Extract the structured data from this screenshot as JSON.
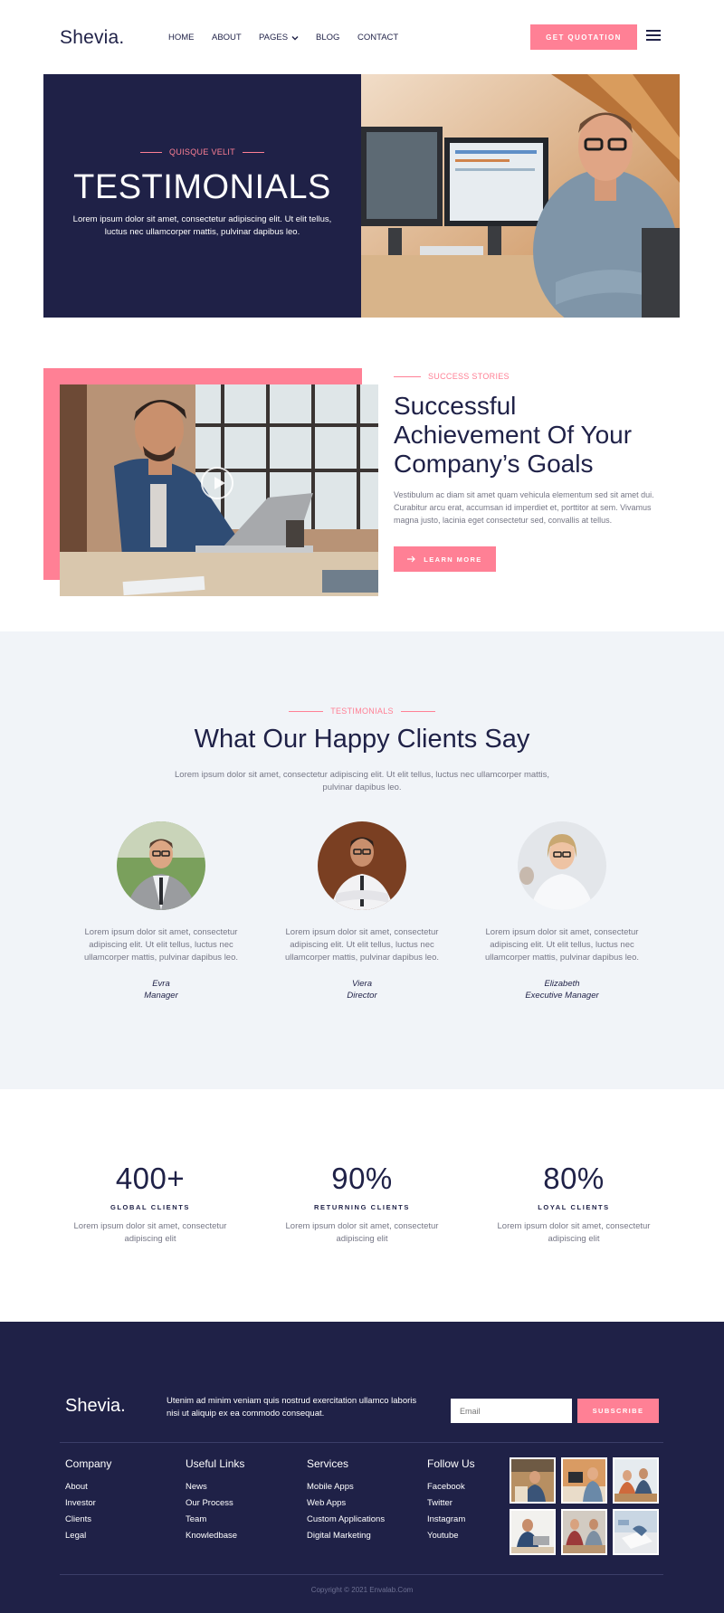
{
  "header": {
    "logo": "Shevia.",
    "nav": [
      {
        "label": "HOME"
      },
      {
        "label": "ABOUT"
      },
      {
        "label": "PAGES"
      },
      {
        "label": "BLOG"
      },
      {
        "label": "CONTACT"
      }
    ],
    "quote_button": "GET QUOTATION",
    "menu_icon": "hamburger-icon"
  },
  "hero": {
    "eyebrow": "QUISQUE VELIT",
    "title": "TESTIMONIALS",
    "subtitle": "Lorem ipsum dolor sit amet, consectetur adipiscing elit. Ut elit tellus, luctus nec ullamcorper mattis, pulvinar dapibus leo."
  },
  "success": {
    "eyebrow": "SUCCESS STORIES",
    "title": "Successful Achievement Of Your Company’s Goals",
    "text": "Vestibulum ac diam sit amet quam vehicula elementum sed sit amet dui. Curabitur arcu erat, accumsan id imperdiet et, porttitor at sem. Vivamus magna justo, lacinia eget consectetur sed, convallis at tellus.",
    "button": "LEARN MORE",
    "button_icon": "arrow-right-icon",
    "video_icon": "play-icon"
  },
  "testimonials": {
    "eyebrow": "TESTIMONIALS",
    "title": "What Our Happy Clients Say",
    "subtitle": "Lorem ipsum dolor sit amet, consectetur adipiscing elit. Ut elit tellus, luctus nec ullamcorper mattis, pulvinar dapibus leo.",
    "items": [
      {
        "quote": "Lorem ipsum dolor sit amet, consectetur adipiscing elit. Ut elit tellus, luctus nec ullamcorper mattis, pulvinar dapibus leo.",
        "name": "Evra",
        "role": "Manager"
      },
      {
        "quote": "Lorem ipsum dolor sit amet, consectetur adipiscing elit. Ut elit tellus, luctus nec ullamcorper mattis, pulvinar dapibus leo.",
        "name": "Viera",
        "role": "Director"
      },
      {
        "quote": "Lorem ipsum dolor sit amet, consectetur adipiscing elit. Ut elit tellus, luctus nec ullamcorper mattis, pulvinar dapibus leo.",
        "name": "Elizabeth",
        "role": "Executive Manager"
      }
    ]
  },
  "stats": [
    {
      "number": "400+",
      "label": "GLOBAL CLIENTS",
      "desc": "Lorem ipsum dolor sit amet, consectetur adipiscing elit"
    },
    {
      "number": "90%",
      "label": "RETURNING CLIENTS",
      "desc": "Lorem ipsum dolor sit amet, consectetur adipiscing elit"
    },
    {
      "number": "80%",
      "label": "LOYAL CLIENTS",
      "desc": "Lorem ipsum dolor sit amet, consectetur adipiscing elit"
    }
  ],
  "footer": {
    "logo": "Shevia.",
    "text": "Utenim ad minim veniam quis nostrud exercitation ullamco laboris nisi ut aliquip ex ea commodo consequat.",
    "email_placeholder": "Email",
    "subscribe": "SUBSCRIBE",
    "columns": [
      {
        "title": "Company",
        "links": [
          "About",
          "Investor",
          "Clients",
          "Legal"
        ]
      },
      {
        "title": "Useful Links",
        "links": [
          "News",
          "Our Process",
          "Team",
          "Knowledbase"
        ]
      },
      {
        "title": "Services",
        "links": [
          "Mobile Apps",
          "Web Apps",
          "Custom Applications",
          "Digital Marketing"
        ]
      },
      {
        "title": "Follow Us",
        "links": [
          "Facebook",
          "Twitter",
          "Instagram",
          "Youtube"
        ]
      }
    ],
    "copyright": "Copyright © 2021 Envalab.Com"
  },
  "colors": {
    "navy": "#1f2147",
    "accent_pink": "#ff8095",
    "light_bg": "#f1f4f8",
    "muted_text": "#767786"
  }
}
